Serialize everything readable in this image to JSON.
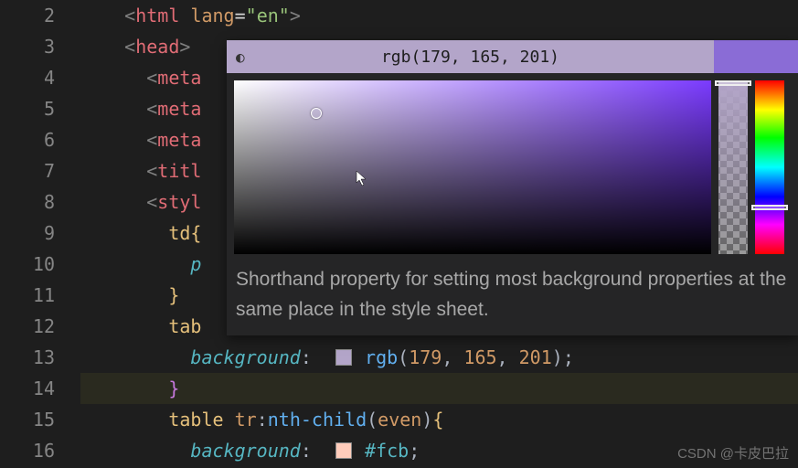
{
  "lineNumbers": [
    "2",
    "3",
    "4",
    "5",
    "6",
    "7",
    "8",
    "9",
    "10",
    "11",
    "12",
    "13",
    "14",
    "15",
    "16"
  ],
  "code": {
    "l2": {
      "tag": "html",
      "attr": "lang",
      "val": "\"en\""
    },
    "l3": {
      "tag": "head"
    },
    "l4": {
      "tag": "meta"
    },
    "l5": {
      "tag": "meta"
    },
    "l6": {
      "tag": "meta"
    },
    "l7": {
      "tag": "titl"
    },
    "l8": {
      "tag": "styl"
    },
    "l9": {
      "sel": "td",
      "brace": "{"
    },
    "l10": {
      "propPartial": "p"
    },
    "l11": {
      "brace": "}"
    },
    "l12": {
      "sel": "tab"
    },
    "l13": {
      "prop": "background",
      "colon": ":",
      "fn": "rgb",
      "a": "179",
      "b": "165",
      "c": "201",
      "semi": ";"
    },
    "l14": {
      "brace": "}"
    },
    "l15": {
      "sel": "table",
      "sel2": "tr",
      "pseudo": "nth-child",
      "arg": "even",
      "brace": "{"
    },
    "l16": {
      "prop": "background",
      "colon": ":",
      "hex": "#fcb",
      "semi": ";"
    }
  },
  "swatches": {
    "rgb": "#b3a5c9",
    "hex": "#ffccbb"
  },
  "colorPicker": {
    "title": "rgb(179, 165, 201)",
    "description": "Shorthand property for setting most background properties at the same place in the style sheet.",
    "headerColor": "#b3a5c9",
    "accentColor": "#8a6cd6"
  },
  "watermark": "CSDN @卡皮巴拉"
}
